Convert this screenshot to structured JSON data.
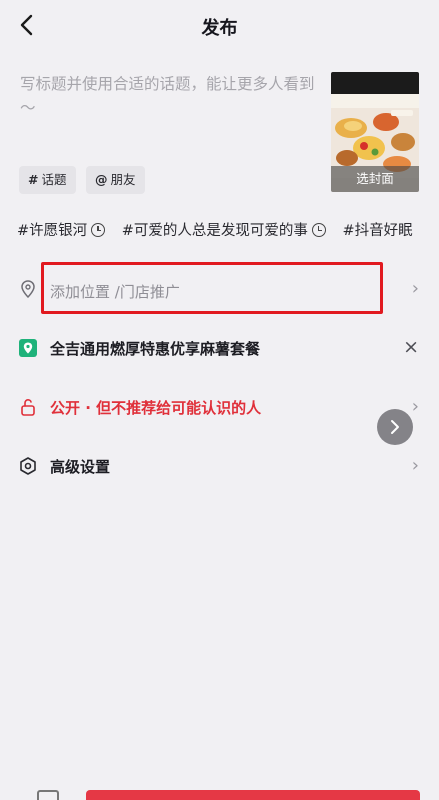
{
  "header": {
    "title": "发布"
  },
  "caption": {
    "placeholder": "写标题并使用合适的话题，能让更多人看到～"
  },
  "cover": {
    "button_label": "选封面"
  },
  "chips": [
    {
      "prefix": "#",
      "label": "话题"
    },
    {
      "prefix": "@",
      "label": "朋友"
    }
  ],
  "topics": [
    "#许愿银河",
    "#可爱的人总是发现可爱的事",
    "#抖音好眠"
  ],
  "location": {
    "label": "添加位置 /门店推广"
  },
  "promo": {
    "label": "全吉通用燃厚特惠优享麻薯套餐",
    "icon_color": "#1fb27a"
  },
  "privacy": {
    "label": "公开 · 但不推荐给可能认识的人",
    "color": "#e0303a"
  },
  "advanced": {
    "label": "高级设置"
  },
  "colors": {
    "highlight": "#e1191f",
    "publish": "#e53845"
  }
}
